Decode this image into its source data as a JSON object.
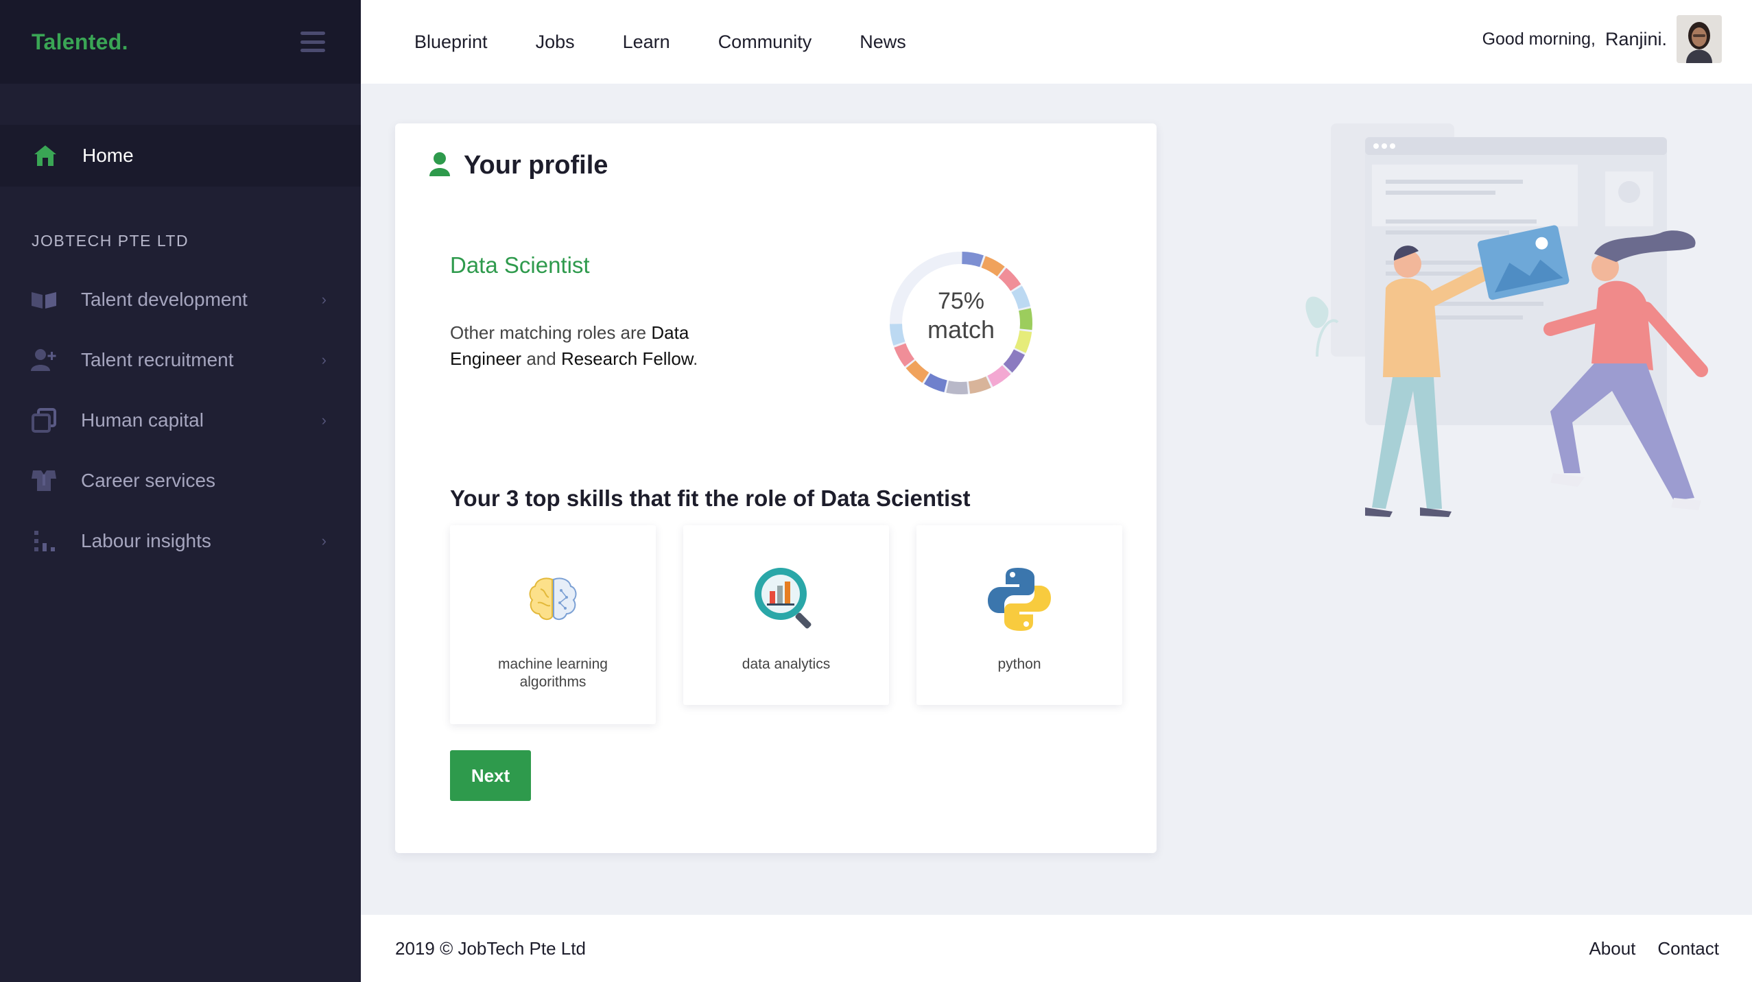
{
  "sidebar": {
    "brand": "Talented",
    "brand_dot": ".",
    "home_label": "Home",
    "company": "JOBTECH PTE LTD",
    "items": [
      {
        "label": "Talent development",
        "icon": "book-icon",
        "chevron": "›"
      },
      {
        "label": "Talent recruitment",
        "icon": "add-user-icon",
        "chevron": "›"
      },
      {
        "label": "Human capital",
        "icon": "copy-icon",
        "chevron": "›"
      },
      {
        "label": "Career services",
        "icon": "shirt-icon"
      },
      {
        "label": "Labour insights",
        "icon": "bar-chart-icon",
        "chevron": "›"
      }
    ]
  },
  "topnav": {
    "links": [
      "Blueprint",
      "Jobs",
      "Learn",
      "Community",
      "News"
    ],
    "greeting": "Good morning,",
    "user_name": "Ranjini."
  },
  "profile": {
    "title": "Your profile",
    "role": "Data Scientist",
    "matching_prefix": "Other matching roles are",
    "match_role_1": "Data Engineer",
    "matching_and": "and",
    "match_role_2": "Research Fellow",
    "matching_suffix": ".",
    "match_percent": "75%",
    "match_word": "match",
    "match_fraction": 0.75,
    "skills_title": "Your 3 top skills that fit the role of Data Scientist",
    "skills": [
      {
        "label": "machine learning algorithms",
        "icon": "brain-icon"
      },
      {
        "label": "data analytics",
        "icon": "magnifier-chart-icon"
      },
      {
        "label": "python",
        "icon": "python-icon"
      }
    ],
    "next_label": "Next"
  },
  "footer": {
    "copyright": "2019 © JobTech Pte Ltd",
    "links": [
      "About",
      "Contact"
    ]
  },
  "colors": {
    "accent": "#2e9a4c",
    "sidebar_bg": "#1f1f33",
    "page_bg": "#eef0f5"
  }
}
